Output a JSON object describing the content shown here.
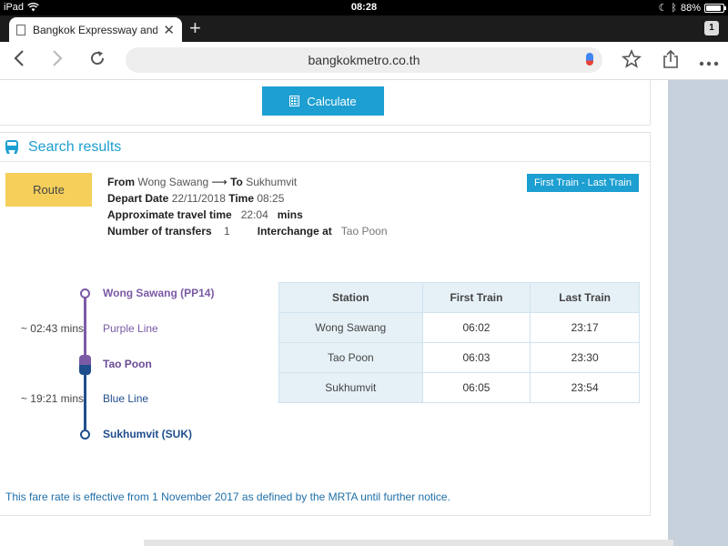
{
  "status_bar": {
    "device": "iPad",
    "time": "08:28",
    "battery": "88%",
    "battery_level": 0.88
  },
  "browser": {
    "tab_title": "Bangkok Expressway and M",
    "tab_count": "1",
    "url": "bangkokmetro.co.th",
    "icons": [
      "back-icon",
      "forward-icon",
      "reload-icon",
      "star-icon",
      "share-icon",
      "more-icon"
    ]
  },
  "page": {
    "calculate_label": "Calculate",
    "results_title": "Search results",
    "route_label": "Route",
    "first_last_label": "First Train - Last Train",
    "trip": {
      "from_label": "From",
      "from": "Wong Sawang",
      "to_label": "To",
      "to": "Sukhumvit",
      "depart_date_label": "Depart Date",
      "depart_date": "22/11/2018",
      "time_label": "Time",
      "time": "08:25",
      "travel_time_label": "Approximate travel time",
      "travel_time": "22:04",
      "travel_unit": "mins",
      "transfers_label": "Number of transfers",
      "transfers": "1",
      "interchange_label": "Interchange at",
      "interchange": "Tao Poon"
    },
    "diagram": {
      "stations": [
        "Wong Sawang (PP14)",
        "Tao Poon",
        "Sukhumvit (SUK)"
      ],
      "segments": [
        {
          "line": "Purple Line",
          "duration": "~ 02:43 mins",
          "color": "#7b5aa6"
        },
        {
          "line": "Blue Line",
          "duration": "~ 19:21 mins",
          "color": "#1f4e8c"
        }
      ]
    },
    "timetable": {
      "headers": [
        "Station",
        "First Train",
        "Last Train"
      ],
      "rows": [
        [
          "Wong Sawang",
          "06:02",
          "23:17"
        ],
        [
          "Tao Poon",
          "06:03",
          "23:30"
        ],
        [
          "Sukhumvit",
          "06:05",
          "23:54"
        ]
      ]
    },
    "note": "This fare rate is effective from 1 November 2017 as defined by the MRTA until further notice."
  },
  "colors": {
    "accent": "#1d9fd1",
    "route_badge": "#f5cf5a",
    "purple_line": "#7b5aa6",
    "blue_line": "#1f4e8c"
  }
}
